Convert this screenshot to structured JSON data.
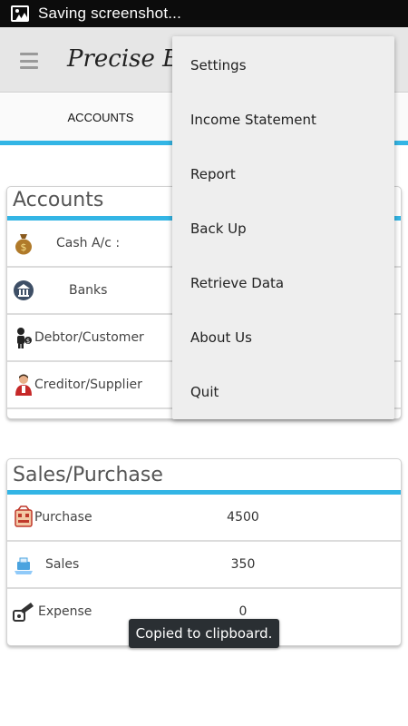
{
  "status_bar": {
    "text": "Saving screenshot...",
    "icon": "image-icon"
  },
  "app_bar": {
    "title": "Precise Erp",
    "menu_icon": "hamburger-icon"
  },
  "tabs": [
    {
      "label": "ACCOUNTS"
    }
  ],
  "accounts": {
    "title": "Accounts",
    "rows": [
      {
        "label": "Cash A/c :",
        "icon": "money-bag-icon"
      },
      {
        "label": "Banks",
        "icon": "bank-icon"
      },
      {
        "label": "Debtor/Customer",
        "icon": "debtor-icon"
      },
      {
        "label": "Creditor/Supplier",
        "icon": "creditor-icon"
      }
    ]
  },
  "sales_purchase": {
    "title": "Sales/Purchase",
    "rows": [
      {
        "label": "Purchase",
        "value": "4500",
        "icon": "purchase-icon"
      },
      {
        "label": "Sales",
        "value": "350",
        "icon": "sales-icon"
      },
      {
        "label": "Expense",
        "value": "0",
        "icon": "expense-icon"
      }
    ]
  },
  "overflow_menu": {
    "items": [
      "Settings",
      "Income Statement",
      "Report",
      "Back Up",
      "Retrieve Data",
      "About Us",
      "Quit"
    ]
  },
  "toast": {
    "text": "Copied to clipboard."
  },
  "colors": {
    "accent": "#33b5e5",
    "app_bar": "#e6e6e6",
    "status_bar": "#0c0c0c",
    "toast": "#2a2f33"
  }
}
